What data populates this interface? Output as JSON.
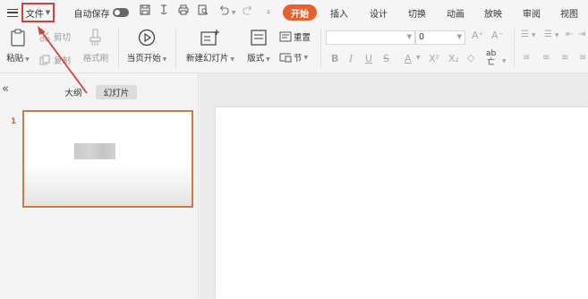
{
  "menubar": {
    "file_label": "文件",
    "autosave_label": "自动保存",
    "tabs": [
      "开始",
      "插入",
      "设计",
      "切换",
      "动画",
      "放映",
      "审阅",
      "视图"
    ]
  },
  "ribbon": {
    "paste_label": "粘贴",
    "cut_label": "剪切",
    "copy_label": "复制",
    "format_painter_label": "格式刷",
    "from_start_label": "当页开始",
    "new_slide_label": "新建幻灯片",
    "layout_label": "版式",
    "reset_label": "重置",
    "section_label": "节",
    "font_size_value": "0"
  },
  "panel": {
    "outline_tab": "大纲",
    "slides_tab": "幻灯片",
    "slide_number": "1"
  },
  "colors": {
    "accent": "#e8612c",
    "highlight_box": "#e03a3a",
    "thumb_border": "#cf7a45"
  }
}
